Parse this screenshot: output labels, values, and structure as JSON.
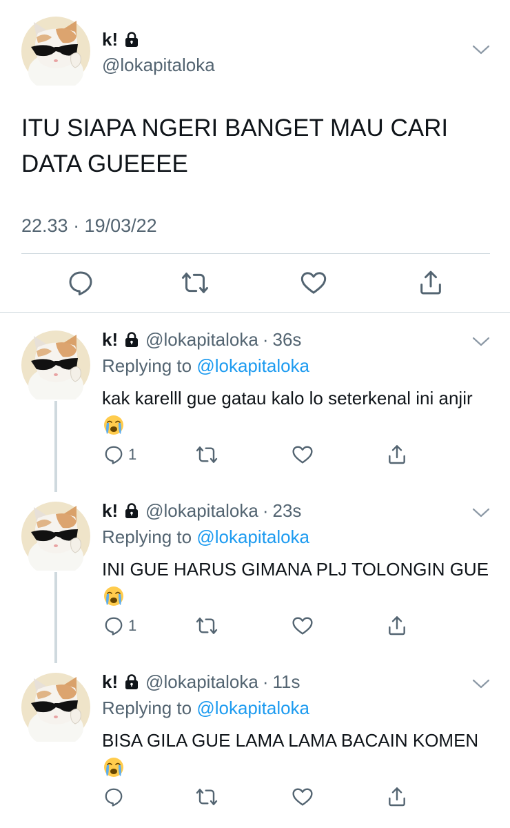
{
  "colors": {
    "text": "#0f1419",
    "secondary": "#536471",
    "link": "#1d9bf0",
    "divider": "#cfd9de"
  },
  "main_tweet": {
    "name": "k!",
    "handle": "@lokapitaloka",
    "text": "ITU SIAPA NGERI BANGET MAU CARI DATA GUEEEE",
    "timestamp": "22.33 · 19/03/22",
    "icons": [
      "lock-icon",
      "chevron-down-icon",
      "reply-icon",
      "retweet-icon",
      "like-icon",
      "share-icon"
    ]
  },
  "replies": [
    {
      "name": "k!",
      "handle": "@lokapitaloka",
      "separator": "·",
      "time": "36s",
      "replying_prefix": "Replying to",
      "replying_to": "@lokapitaloka",
      "text": "kak karelll gue gatau kalo lo seterkenal ini anjir",
      "emoji": "loudly-crying-face",
      "reply_count": "1"
    },
    {
      "name": "k!",
      "handle": "@lokapitaloka",
      "separator": "·",
      "time": "23s",
      "replying_prefix": "Replying to",
      "replying_to": "@lokapitaloka",
      "text": "INI GUE HARUS GIMANA PLJ TOLONGIN GUE",
      "emoji": "loudly-crying-face",
      "reply_count": "1"
    },
    {
      "name": "k!",
      "handle": "@lokapitaloka",
      "separator": "·",
      "time": "11s",
      "replying_prefix": "Replying to",
      "replying_to": "@lokapitaloka",
      "text": "BISA GILA GUE LAMA LAMA BACAIN KOMEN",
      "emoji": "loudly-crying-face",
      "reply_count": ""
    }
  ]
}
